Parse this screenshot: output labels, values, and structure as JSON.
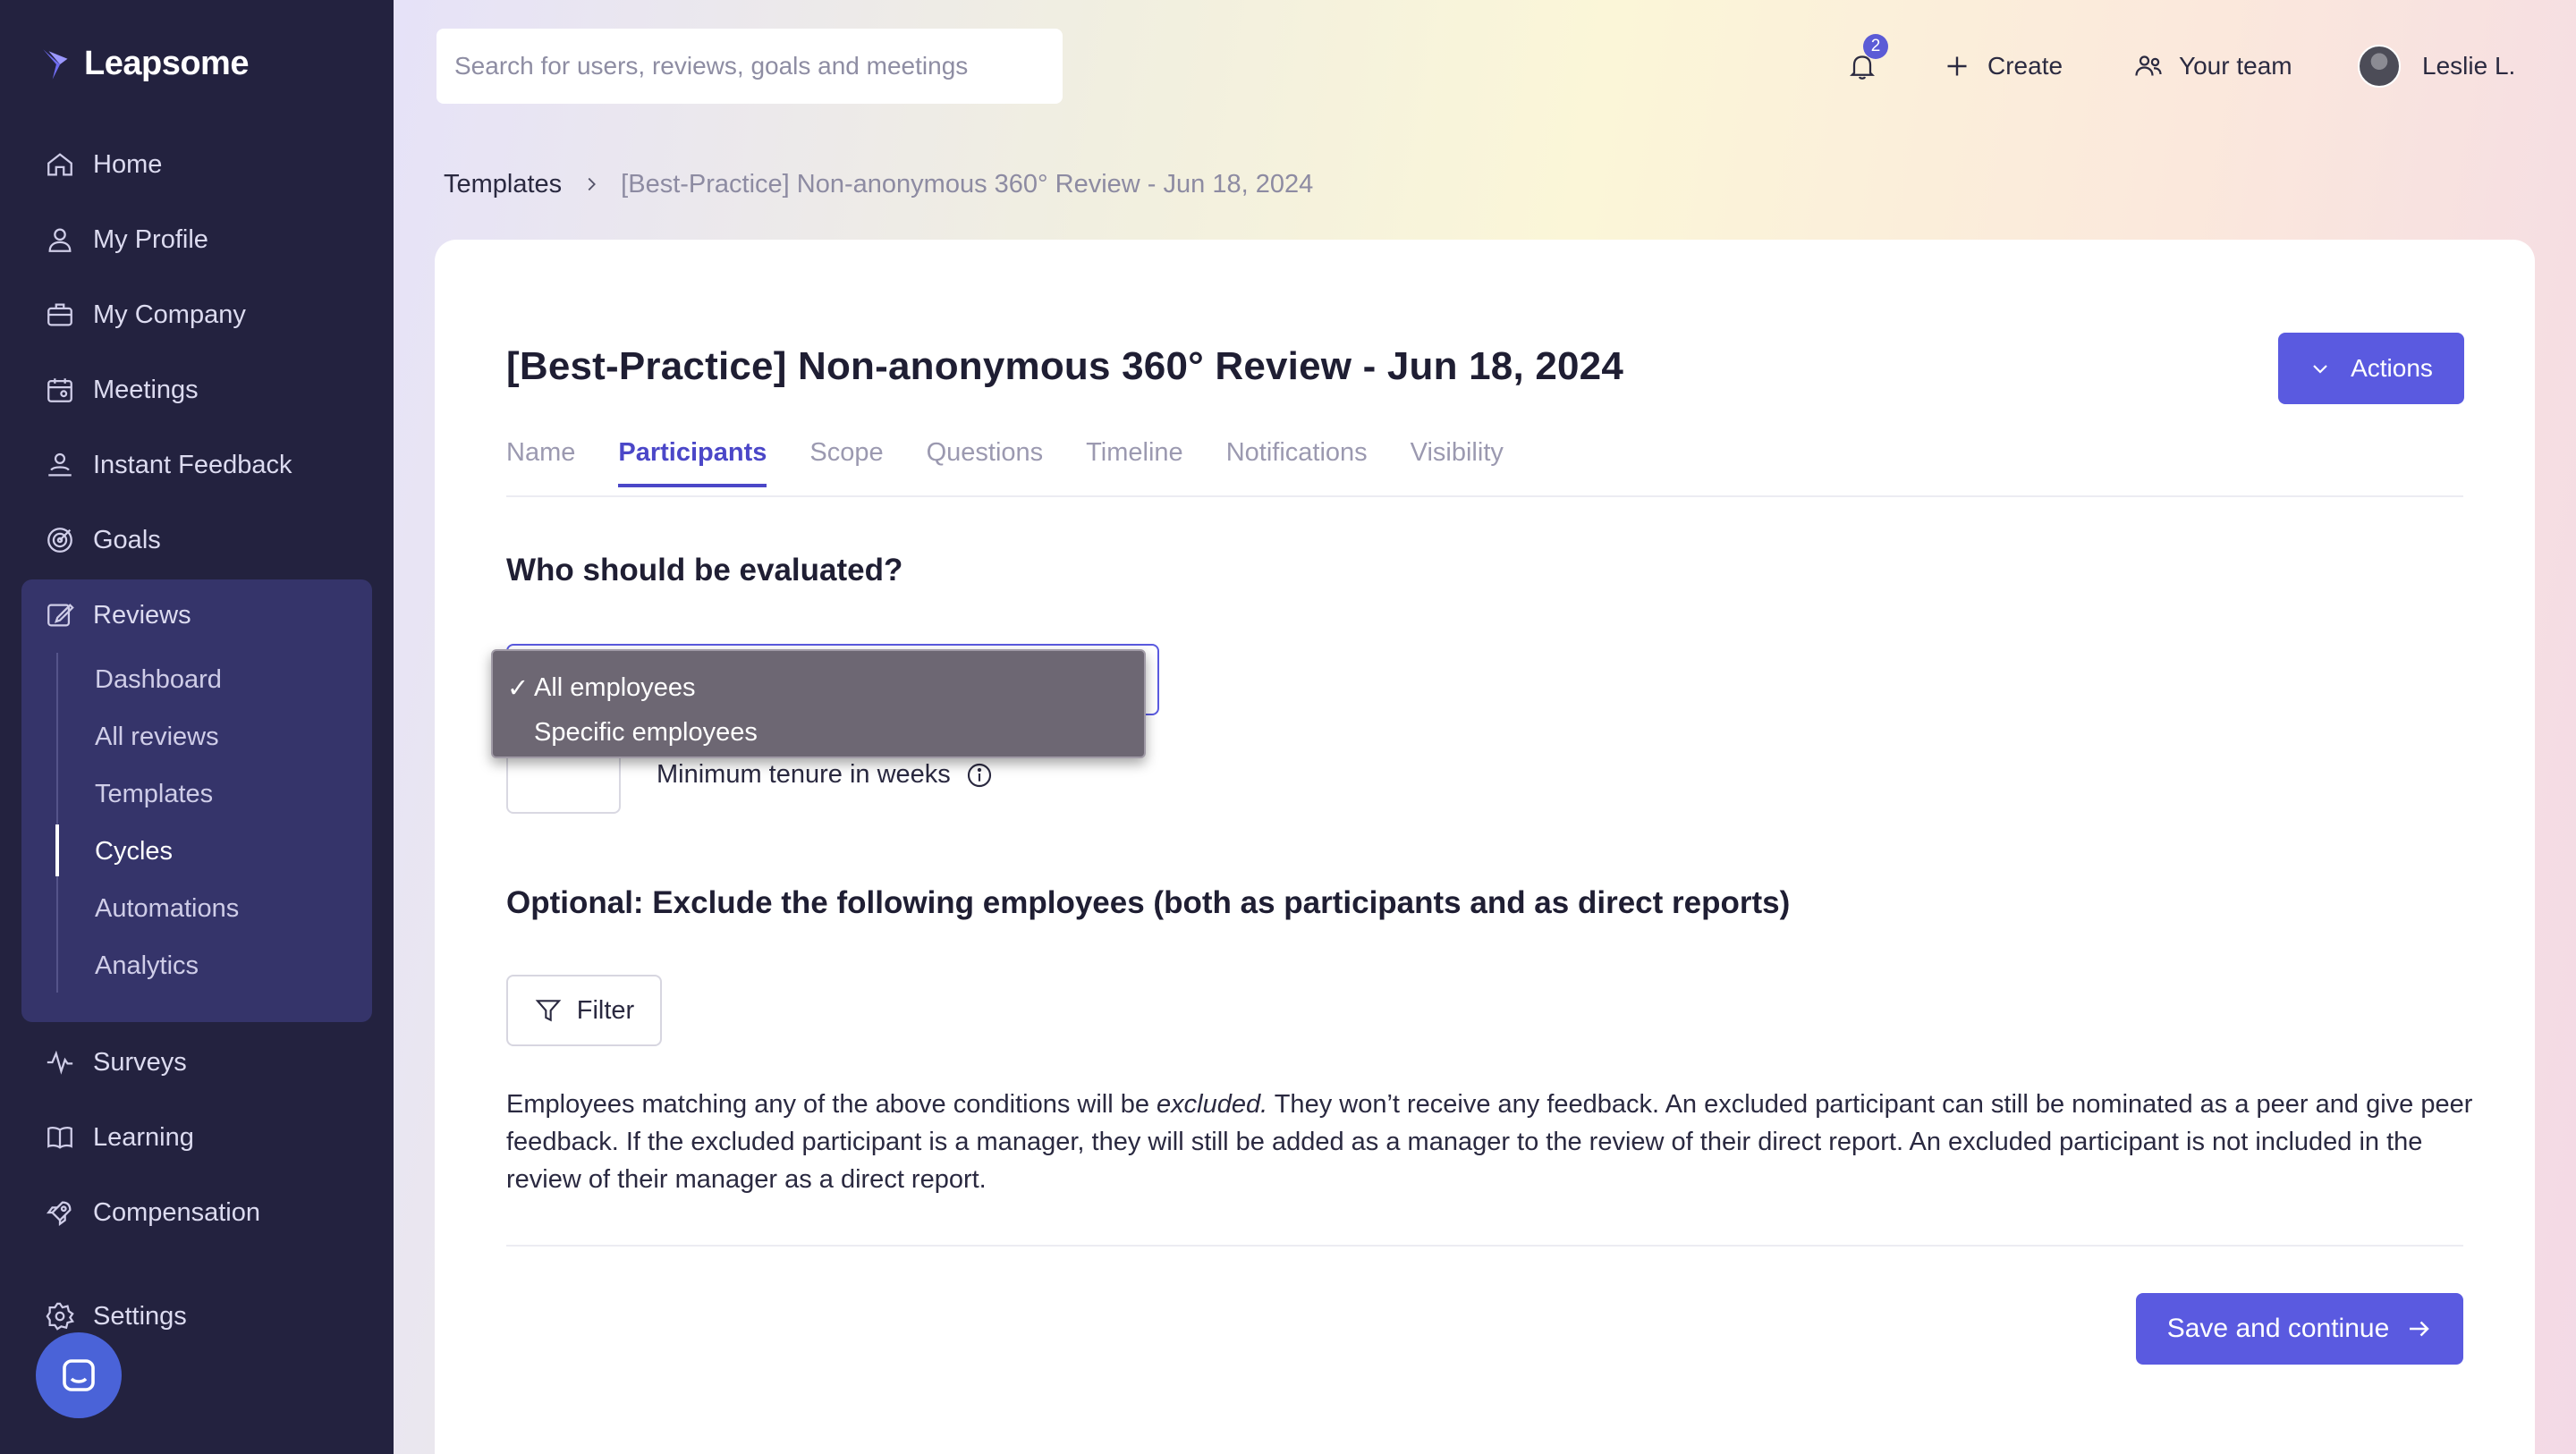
{
  "app": {
    "brand": "Leapsome"
  },
  "sidebar": {
    "items": [
      {
        "label": "Home",
        "icon": "home-icon"
      },
      {
        "label": "My Profile",
        "icon": "user-icon"
      },
      {
        "label": "My Company",
        "icon": "briefcase-icon"
      },
      {
        "label": "Meetings",
        "icon": "calendar-icon"
      },
      {
        "label": "Instant Feedback",
        "icon": "feedback-icon"
      },
      {
        "label": "Goals",
        "icon": "target-icon"
      },
      {
        "label": "Reviews",
        "icon": "edit-icon"
      },
      {
        "label": "Surveys",
        "icon": "pulse-icon"
      },
      {
        "label": "Learning",
        "icon": "book-icon"
      },
      {
        "label": "Compensation",
        "icon": "rocket-icon"
      },
      {
        "label": "Settings",
        "icon": "gear-icon"
      }
    ],
    "reviews_sub": [
      {
        "label": "Dashboard"
      },
      {
        "label": "All reviews"
      },
      {
        "label": "Templates"
      },
      {
        "label": "Cycles"
      },
      {
        "label": "Automations"
      },
      {
        "label": "Analytics"
      }
    ],
    "active_sub": "Cycles"
  },
  "topbar": {
    "search_placeholder": "Search for users, reviews, goals and meetings",
    "notification_count": "2",
    "create_label": "Create",
    "team_label": "Your team",
    "user_name": "Leslie L."
  },
  "breadcrumb": {
    "parent": "Templates",
    "current": "[Best-Practice] Non-anonymous 360° Review - Jun 18, 2024"
  },
  "page": {
    "title": "[Best-Practice] Non-anonymous 360° Review - Jun 18, 2024",
    "actions_label": "Actions",
    "tabs": [
      "Name",
      "Participants",
      "Scope",
      "Questions",
      "Timeline",
      "Notifications",
      "Visibility"
    ],
    "active_tab": "Participants",
    "question": "Who should be evaluated?",
    "dropdown": {
      "options": [
        "All employees",
        "Specific employees"
      ],
      "selected": "All employees",
      "check": "✓"
    },
    "tenure_label": "Minimum tenure in weeks",
    "exclude_title": "Optional: Exclude the following employees (both as participants and as direct reports)",
    "filter_label": "Filter",
    "description": {
      "before": "Employees matching any of the above conditions will be ",
      "emphasis": "excluded.",
      "after": " They won’t receive any feedback. An excluded participant can still be nominated as a peer and give peer feedback. If the excluded participant is a manager, they will still be added as a manager to the review of their direct report. An excluded participant is not included in the review of their manager as a direct report."
    },
    "save_label": "Save and continue"
  },
  "colors": {
    "sidebar_bg": "#23223f",
    "accent": "#5a5ae0",
    "reviews_block": "#35346a"
  }
}
